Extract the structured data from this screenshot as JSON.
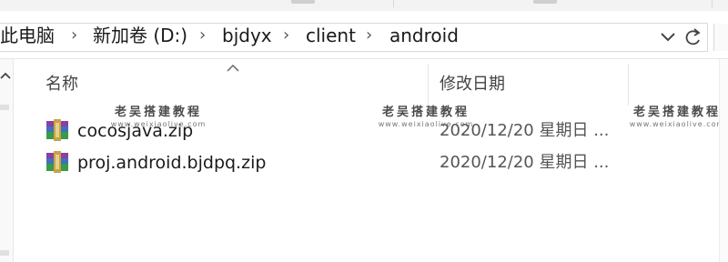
{
  "breadcrumb": {
    "items": [
      "此电脑",
      "新加卷 (D:)",
      "bjdyx",
      "client",
      "android"
    ],
    "separator": "›"
  },
  "icons": {
    "dropdown": "chevron-down-icon",
    "refresh": "refresh-icon",
    "sort": "sort-ascending-icon",
    "file": "winrar-archive-icon"
  },
  "columns": {
    "name": "名称",
    "date": "修改日期"
  },
  "files": [
    {
      "name": "cocosjava.zip",
      "date": "2020/12/20 星期日 ..."
    },
    {
      "name": "proj.android.bjdpq.zip",
      "date": "2020/12/20 星期日 ..."
    }
  ],
  "watermark": {
    "title": "老吴搭建教程",
    "url": "www.weixiaolive.com"
  },
  "colors": {
    "border": "#d9d9d9",
    "text": "#1a1a1a",
    "header_text": "#444444"
  }
}
